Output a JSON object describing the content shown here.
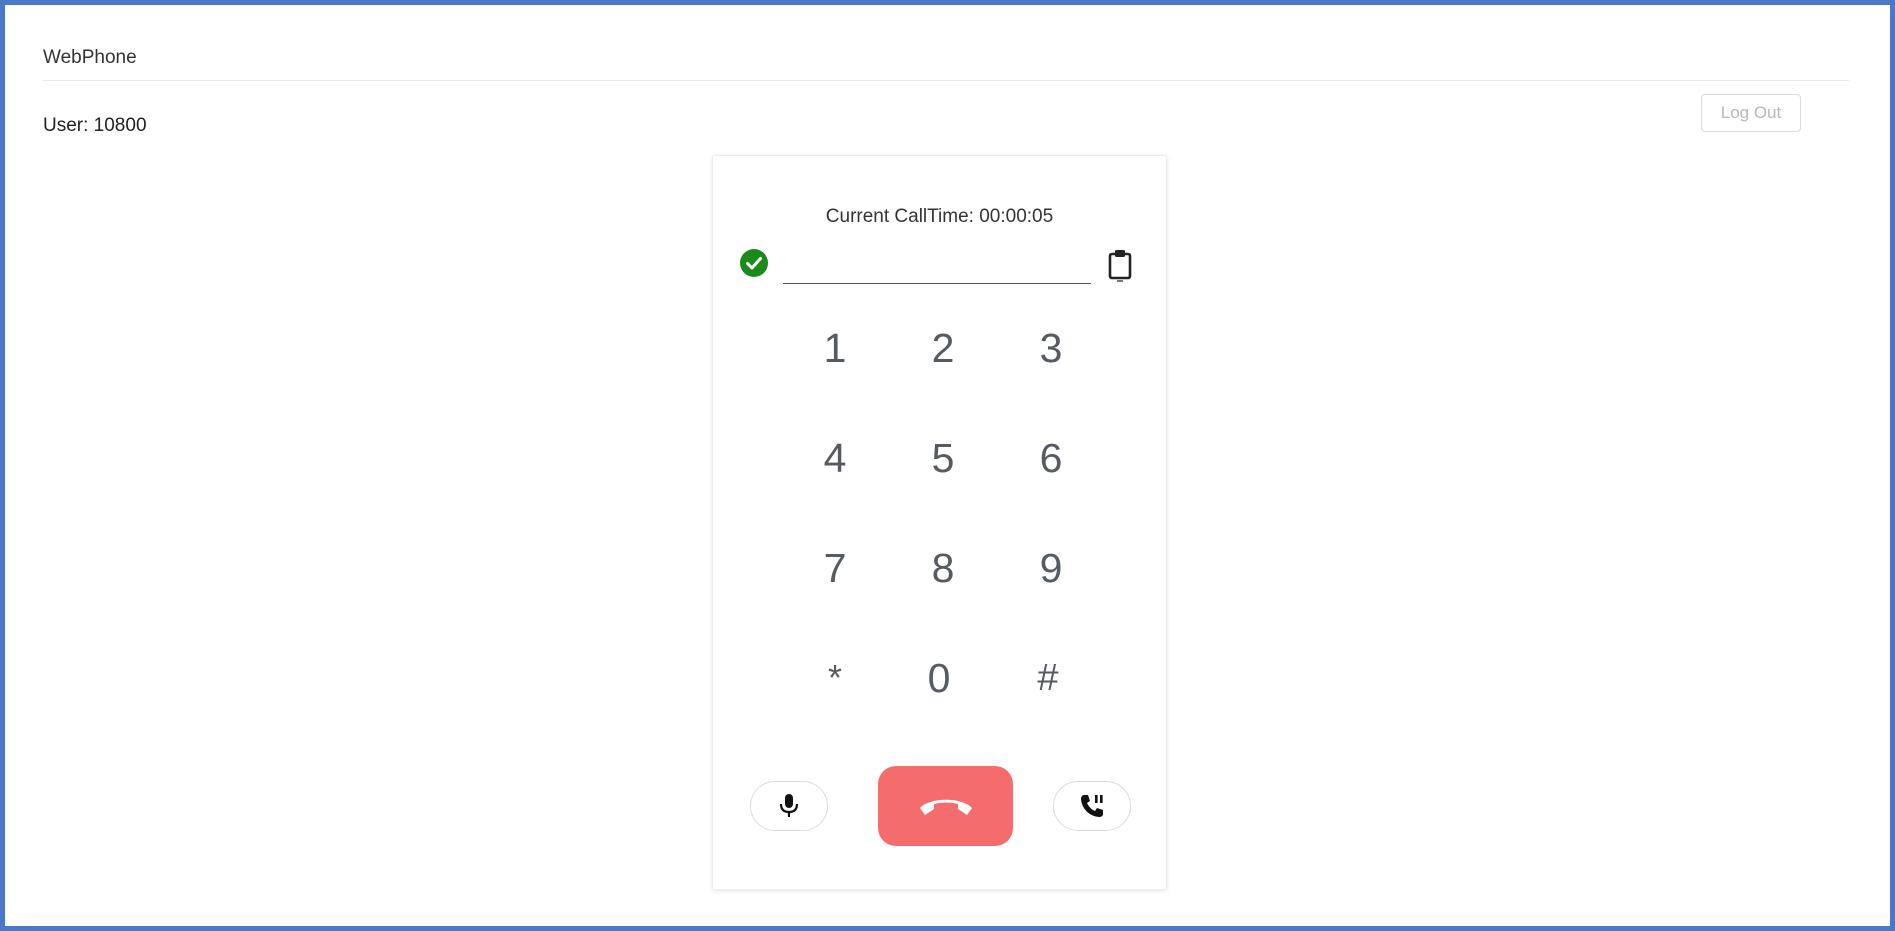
{
  "header": {
    "title": "WebPhone",
    "user_label": "User: 10800",
    "logout_label": "Log Out"
  },
  "dialer": {
    "calltime_label": "Current CallTime: ",
    "calltime_value": "00:00:05",
    "input_value": "",
    "status_icon": "check-circle-icon",
    "paste_icon": "clipboard-icon",
    "keys": [
      "1",
      "2",
      "3",
      "4",
      "5",
      "6",
      "7",
      "8",
      "9",
      "*",
      "0",
      "#"
    ],
    "controls": {
      "mute_icon": "microphone-icon",
      "hangup_icon": "phone-hangup-icon",
      "hold_icon": "phone-pause-icon"
    }
  },
  "colors": {
    "frame_border": "#4a78c8",
    "status_ok": "#1a8a1a",
    "hangup": "#f56c6c",
    "key_text": "#555b61"
  }
}
